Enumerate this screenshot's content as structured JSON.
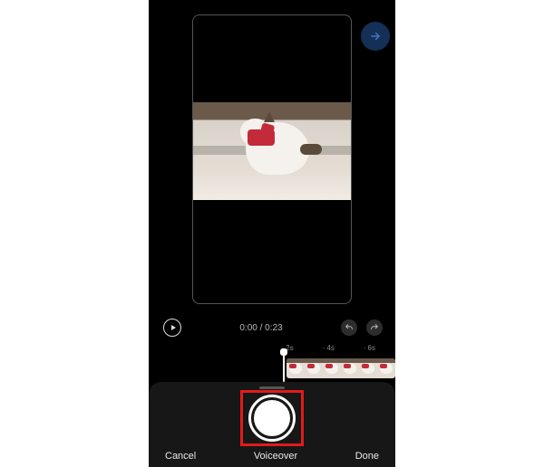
{
  "preview": {
    "current_time": "0:00",
    "separator": " / ",
    "duration": "0:23"
  },
  "speed_markers": [
    "2s",
    "4s",
    "6s"
  ],
  "voiceover": {
    "cancel": "Cancel",
    "title": "Voiceover",
    "done": "Done"
  },
  "icons": {
    "next": "next-arrow-icon",
    "play": "play-icon",
    "undo": "undo-icon",
    "redo": "redo-icon",
    "record": "record-icon",
    "handle": "panel-handle"
  }
}
